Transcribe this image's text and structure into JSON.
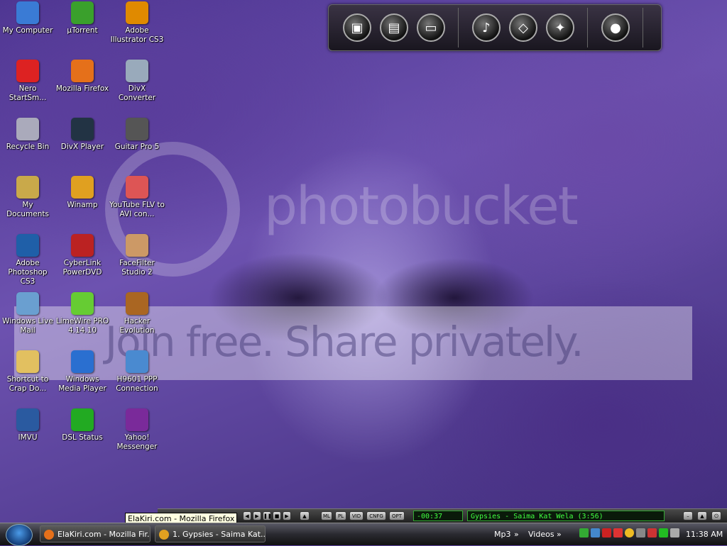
{
  "desktop": {
    "icons": [
      {
        "label": "My Computer",
        "icon": "computer-icon",
        "color": "#3a7bd5"
      },
      {
        "label": "µTorrent",
        "icon": "utorrent-icon",
        "color": "#3aa02c"
      },
      {
        "label": "Adobe Illustrator CS3",
        "icon": "illustrator-icon",
        "color": "#e08a00"
      },
      {
        "label": "Nero StartSm...",
        "icon": "nero-icon",
        "color": "#d22"
      },
      {
        "label": "Mozilla Firefox",
        "icon": "firefox-icon",
        "color": "#e5701a"
      },
      {
        "label": "DivX Converter",
        "icon": "divx-converter-icon",
        "color": "#9ab"
      },
      {
        "label": "Recycle Bin",
        "icon": "recycle-bin-icon",
        "color": "#aab"
      },
      {
        "label": "DivX Player",
        "icon": "divx-player-icon",
        "color": "#234"
      },
      {
        "label": "Guitar Pro 5",
        "icon": "guitar-pro-icon",
        "color": "#555"
      },
      {
        "label": "My Documents",
        "icon": "folder-icon",
        "color": "#c9a94a"
      },
      {
        "label": "Winamp",
        "icon": "winamp-icon",
        "color": "#e0a020"
      },
      {
        "label": "YouTube FLV to AVI con...",
        "icon": "youtube-converter-icon",
        "color": "#d55"
      },
      {
        "label": "Adobe Photoshop CS3",
        "icon": "photoshop-icon",
        "color": "#1f5fa8"
      },
      {
        "label": "CyberLink PowerDVD",
        "icon": "powerdvd-icon",
        "color": "#b22"
      },
      {
        "label": "FaceFilter Studio 2",
        "icon": "facefilter-icon",
        "color": "#c96"
      },
      {
        "label": "Windows Live Mail",
        "icon": "mail-icon",
        "color": "#6a9fd0"
      },
      {
        "label": "LimeWire PRO 4.14.10",
        "icon": "limewire-icon",
        "color": "#6c3"
      },
      {
        "label": "Hacker Evolution",
        "icon": "hacker-evolution-icon",
        "color": "#a62"
      },
      {
        "label": "Shortcut to Crap Do...",
        "icon": "folder-shortcut-icon",
        "color": "#e2c060"
      },
      {
        "label": "Windows Media Player",
        "icon": "media-player-icon",
        "color": "#2a6fd0"
      },
      {
        "label": "H9601 PPP Connection",
        "icon": "network-connection-icon",
        "color": "#4a8ad0"
      },
      {
        "label": "IMVU",
        "icon": "imvu-icon",
        "color": "#2a5aa0"
      },
      {
        "label": "DSL Status",
        "icon": "dsl-status-icon",
        "color": "#2a2"
      },
      {
        "label": "Yahoo! Messenger",
        "icon": "yahoo-messenger-icon",
        "color": "#7a2a9a"
      }
    ]
  },
  "watermark": {
    "brand": "photobucket",
    "tagline": "Join free. Share privately."
  },
  "dock": {
    "items": [
      {
        "name": "dock-windows-icon",
        "glyph": "▣"
      },
      {
        "name": "dock-documents-icon",
        "glyph": "▤"
      },
      {
        "name": "dock-drive-icon",
        "glyph": "▭"
      },
      {
        "name": "dock-music-icon",
        "glyph": "♪"
      },
      {
        "name": "dock-shapes-icon",
        "glyph": "◇"
      },
      {
        "name": "dock-butterfly-icon",
        "glyph": "✦"
      },
      {
        "name": "dock-firefox-icon",
        "glyph": "●"
      }
    ]
  },
  "tooltip": {
    "text": "ElaKiri.com - Mozilla Firefox"
  },
  "player": {
    "buttons": [
      "ML",
      "PL",
      "VID",
      "CNFG",
      "OPT"
    ],
    "time": "-00:37",
    "track": "Gypsies - Saima Kat Wela (3:56)"
  },
  "taskbar": {
    "tasks": [
      {
        "label": "ElaKiri.com - Mozilla Fir...",
        "icon": "firefox-icon"
      },
      {
        "label": "1. Gypsies - Saima Kat...",
        "icon": "winamp-icon"
      }
    ],
    "links": [
      "Mp3",
      "»",
      "Videos",
      "»"
    ],
    "clock": "11:38 AM"
  }
}
